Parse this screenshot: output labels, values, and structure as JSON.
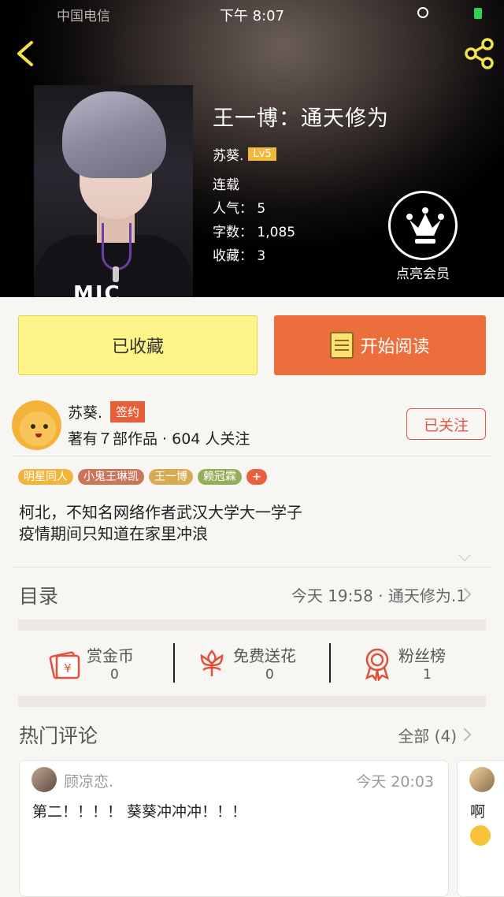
{
  "status_bar": {
    "carrier": "中国电信",
    "time": "下午 8:07"
  },
  "book": {
    "title": "王一博：通天修为",
    "author": "苏葵.",
    "level": "Lv5",
    "state": "连载",
    "popularity": "人气：  5",
    "word_count": "字数：  1,085",
    "favorites": "收藏：  3",
    "cover_text": "MIC"
  },
  "vip": {
    "label": "点亮会员"
  },
  "actions": {
    "favorited": "已收藏",
    "read": "开始阅读"
  },
  "author_card": {
    "name": "苏葵.",
    "badge": "签约",
    "stats": "著有７部作品 · 604 人关注",
    "follow": "已关注"
  },
  "tags": [
    {
      "label": "明星同人",
      "color": "#f0b53c"
    },
    {
      "label": "小鬼王琳凯",
      "color": "#c9765a"
    },
    {
      "label": "王一博",
      "color": "#d8ab52"
    },
    {
      "label": "赖冠霖",
      "color": "#96ad58"
    }
  ],
  "tag_more": "+",
  "description": {
    "line1": "柯北，不知名网络作者武汉大学大一学子",
    "line2": "疫情期间只知道在家里冲浪"
  },
  "toc": {
    "label": "目录",
    "latest": "今天 19:58 · 通天修为.1"
  },
  "stats": {
    "reward": {
      "label": "赏金币",
      "value": "0"
    },
    "flowers": {
      "label": "免费送花",
      "value": "0"
    },
    "fans": {
      "label": "粉丝榜",
      "value": "1"
    }
  },
  "comments": {
    "label": "热门评论",
    "all": "全部 (4)",
    "items": [
      {
        "user": "顾凉恋.",
        "time": "今天 20:03",
        "text": "第二！！！！ 葵葵冲冲冲！！！"
      },
      {
        "text": "啊"
      }
    ]
  },
  "colors": {
    "accent_orange": "#ec6e3d",
    "fav_yellow": "#fdf58a",
    "follow_red": "#e2574c",
    "icon_red": "#e2503a"
  }
}
